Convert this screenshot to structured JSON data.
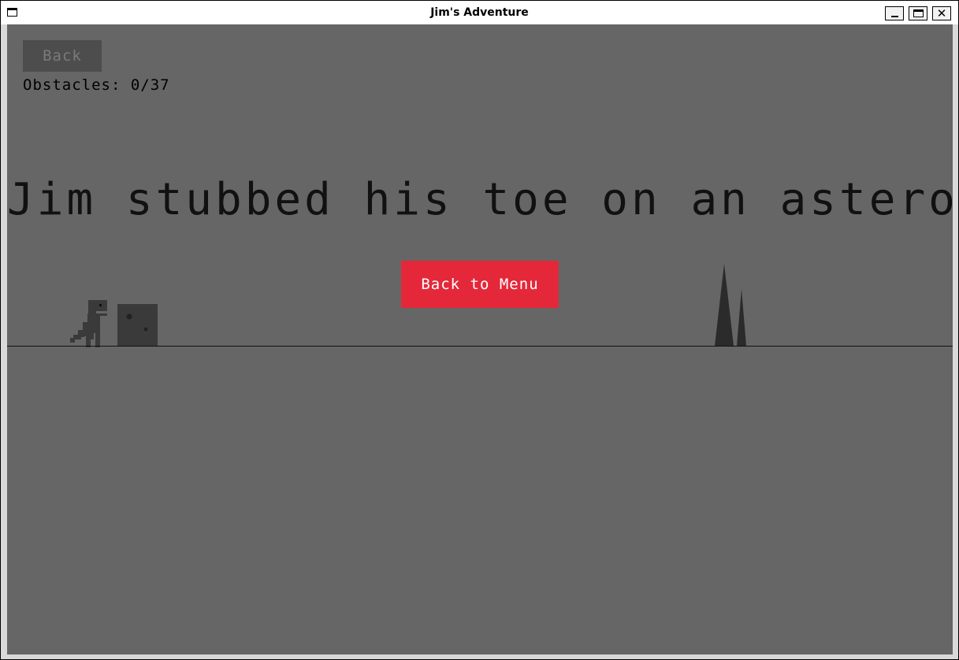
{
  "window": {
    "title": "Jim's Adventure",
    "close_glyph": "✕"
  },
  "game": {
    "back_label": "Back",
    "obstacles_label": "Obstacles:",
    "obstacles_count": "0/37",
    "message": "Jim stubbed his toe on an asteroid.",
    "menu_button_label": "Back to Menu"
  },
  "colors": {
    "background": "#666666",
    "menu_button": "#e4283a",
    "back_button": "#4d4d4d",
    "text": "#111111"
  },
  "icons": [
    "window-icon",
    "minimize-icon",
    "maximize-icon",
    "close-icon"
  ]
}
